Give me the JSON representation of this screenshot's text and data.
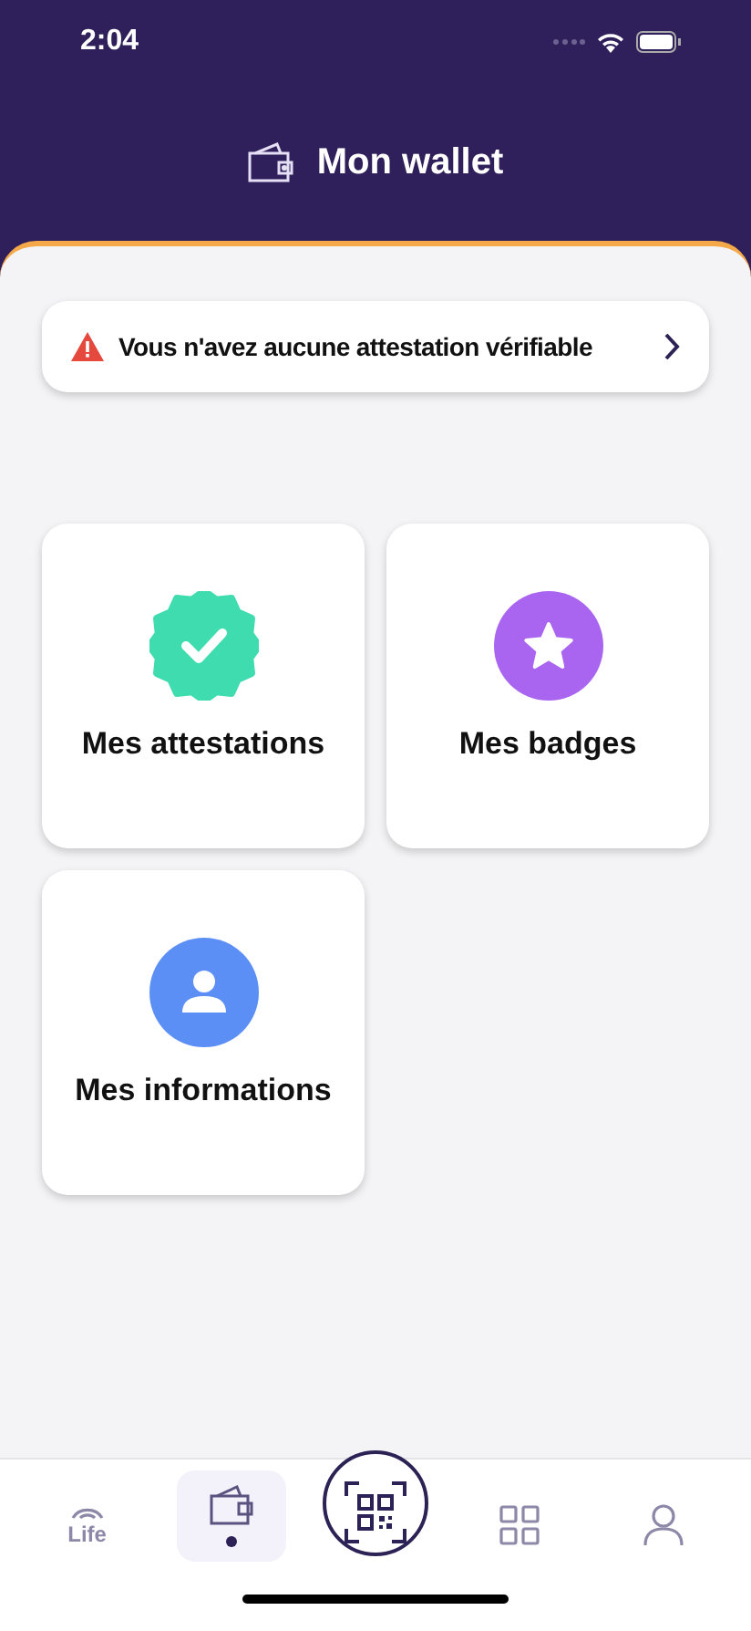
{
  "status_bar": {
    "time": "2:04"
  },
  "header": {
    "title": "Mon wallet"
  },
  "alert": {
    "text": "Vous n'avez aucune attestation vérifiable"
  },
  "cards": [
    {
      "kind": "attestations",
      "label": "Mes attestations",
      "color": "#3fdcaf"
    },
    {
      "kind": "badges",
      "label": "Mes badges",
      "color": "#a964f0"
    },
    {
      "kind": "informations",
      "label": "Mes informations",
      "color": "#5b8ff5"
    }
  ],
  "tab_bar": [
    {
      "kind": "life",
      "label": "Life",
      "selected": false
    },
    {
      "kind": "wallet",
      "selected": true
    },
    {
      "kind": "scan",
      "selected": false
    },
    {
      "kind": "apps",
      "selected": false
    },
    {
      "kind": "profile",
      "selected": false
    }
  ]
}
